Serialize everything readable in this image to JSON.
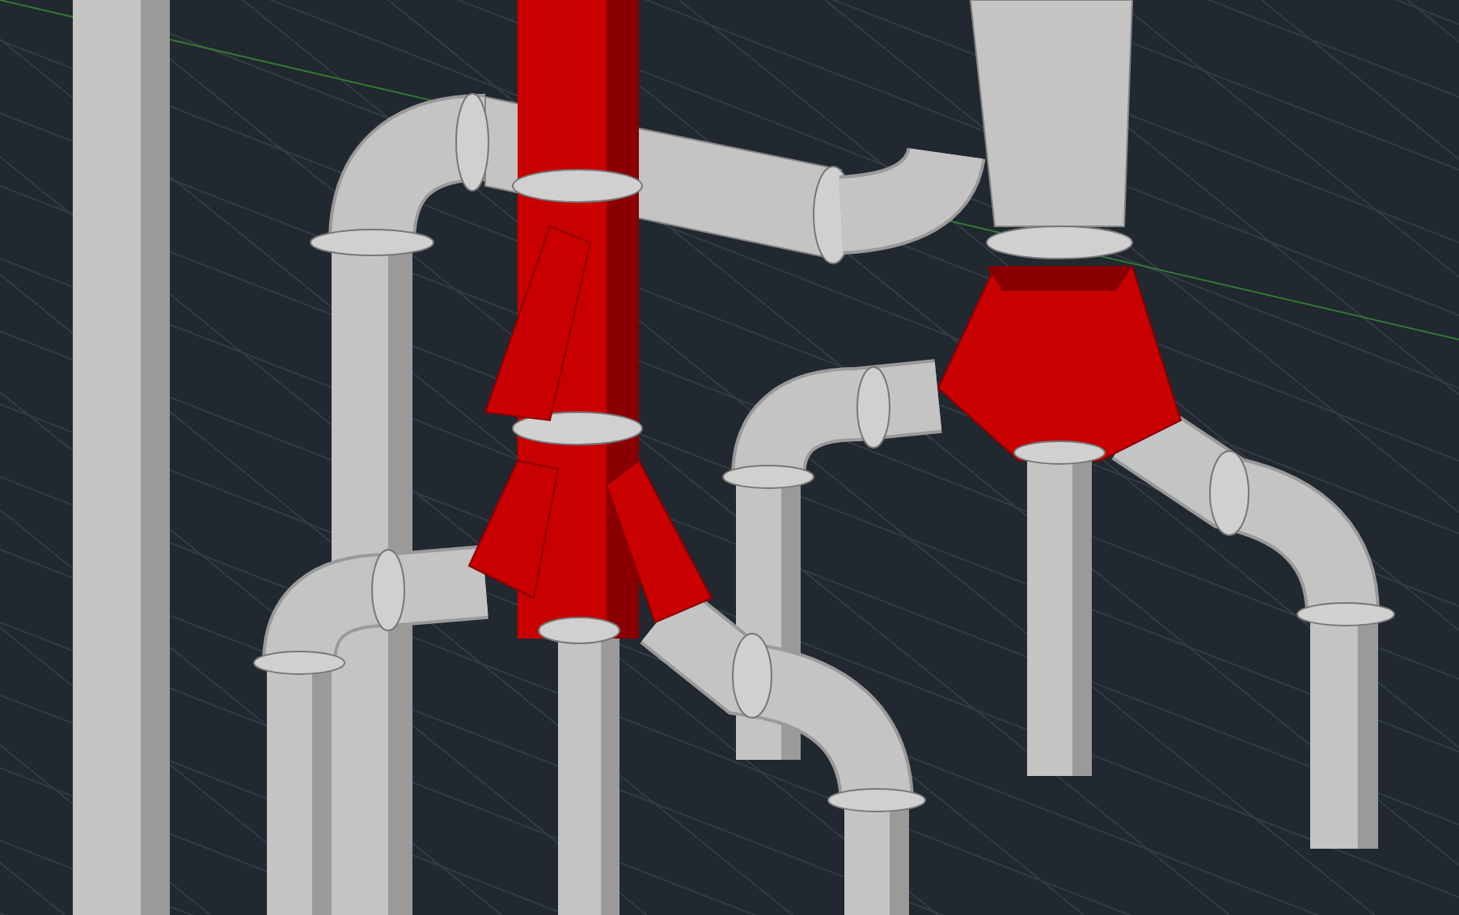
{
  "viewport": {
    "grid": true
  }
}
